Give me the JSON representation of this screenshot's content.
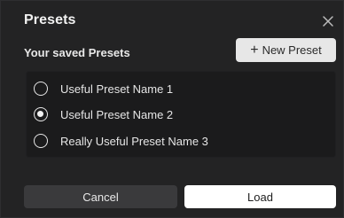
{
  "dialog": {
    "title": "Presets",
    "subtitle": "Your saved Presets",
    "new_preset_label": "New Preset",
    "presets": [
      {
        "label": "Useful Preset Name 1",
        "selected": false
      },
      {
        "label": "Useful Preset Name 2",
        "selected": true
      },
      {
        "label": "Really Useful Preset Name 3",
        "selected": false
      }
    ],
    "cancel_label": "Cancel",
    "load_label": "Load"
  },
  "icons": {
    "close": "close-icon",
    "plus": "plus-icon"
  },
  "colors": {
    "background": "#232324",
    "list_background": "#1b1b1c",
    "primary_button": "#ffffff",
    "secondary_button": "#3a3a3c",
    "text": "#e6e6e6"
  }
}
